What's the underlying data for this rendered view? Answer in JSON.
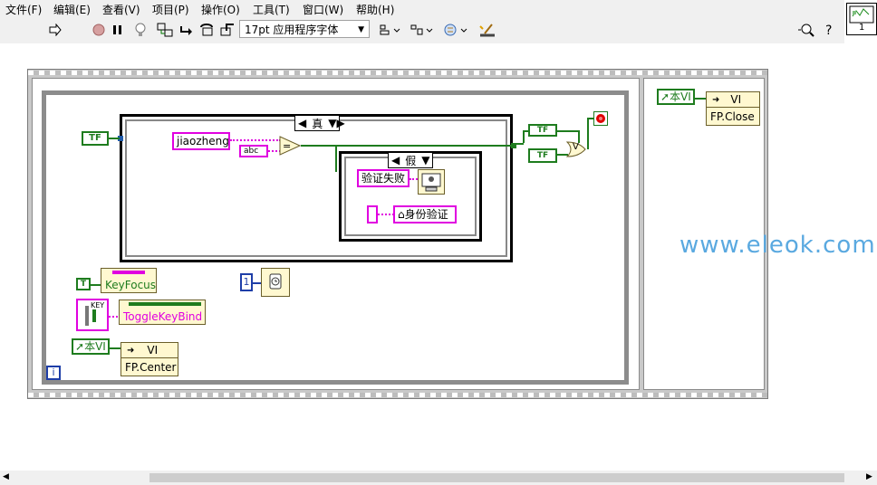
{
  "menu": [
    "文件(F)",
    "编辑(E)",
    "查看(V)",
    "项目(P)",
    "操作(O)",
    "工具(T)",
    "窗口(W)",
    "帮助(H)"
  ],
  "toolbar": {
    "font_selector": "17pt 应用程序字体",
    "icons": [
      "run-arrow-icon",
      "abort-icon",
      "pause-icon",
      "highlight-bulb-icon",
      "retain-wire-icon",
      "step-into-icon",
      "step-over-icon",
      "step-out-icon",
      "align-icon",
      "distribute-icon",
      "reorder-icon",
      "cleanup-icon",
      "search-icon",
      "help-icon"
    ]
  },
  "vi_icon_label": "1",
  "diagram": {
    "tf_constant": "TF",
    "string_constant": "jiaozheng",
    "string_control": "abc",
    "case_true": "真",
    "case_false": "假",
    "fail_text": "验证失败",
    "verify_ref": "身份验证",
    "tf_a": "TF",
    "tf_b": "TF",
    "or_label": "V",
    "keyfocus_const": "T",
    "keyfocus_prop": "KeyFocus",
    "togglekey_prop": "ToggleKeyBind",
    "key_label": "KEY",
    "this_vi_a": "本VI",
    "vi_label_a": "VI",
    "fp_center": "FP.Center",
    "wait_const": "1",
    "iter_label": "i",
    "this_vi_b": "本VI",
    "vi_label_b": "VI",
    "fp_close": "FP.Close"
  },
  "watermark": "www.eleok.com"
}
